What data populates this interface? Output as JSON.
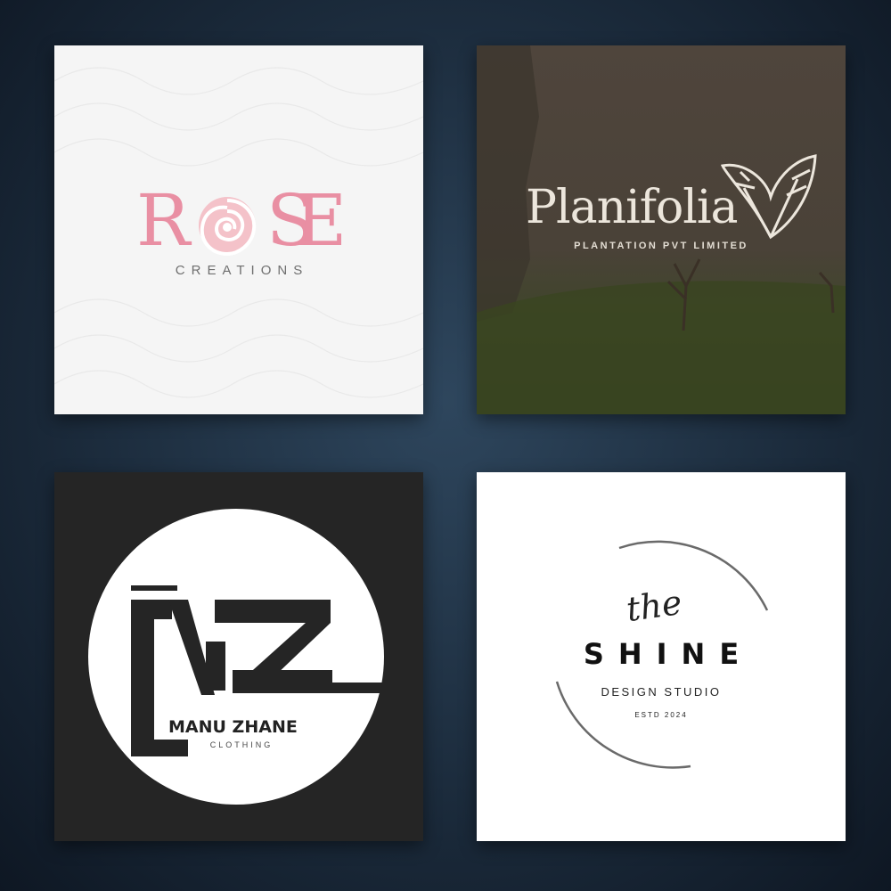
{
  "logos": [
    {
      "brand_letters": [
        "R",
        "O",
        "S",
        "E"
      ],
      "tagline": "CREATIONS",
      "colors": {
        "primary": "#e98fa3",
        "light": "#f4c2c9",
        "text": "#6f6f6f",
        "background": "#f5f5f5"
      }
    },
    {
      "brand": "Planifolia",
      "tagline": "PLANTATION PVT LIMITED",
      "icon": "leaves-icon",
      "colors": {
        "text": "#ece6dc",
        "background": "#4a3f36",
        "field": "#3d4a2a"
      }
    },
    {
      "monogram": "MZ",
      "brand": "MANU ZHANE",
      "tagline": "CLOTHING",
      "colors": {
        "background": "#252525",
        "circle": "#ffffff",
        "text": "#222222"
      }
    },
    {
      "prefix": "the",
      "brand": "SHINE",
      "tagline": "DESIGN STUDIO",
      "established": "ESTD 2024",
      "colors": {
        "text": "#111111",
        "ring": "#6a6a6a",
        "background": "#ffffff"
      }
    }
  ]
}
